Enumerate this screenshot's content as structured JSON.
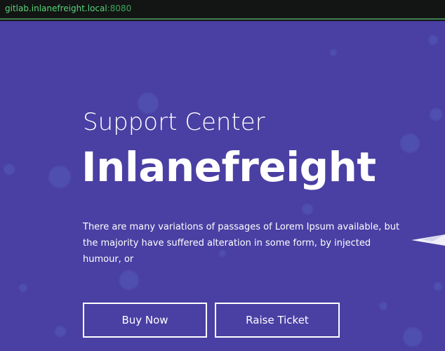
{
  "browser": {
    "url_host": "gitlab.inlanefreight.local",
    "url_port": ":8080"
  },
  "hero": {
    "subtitle": "Support Center",
    "title": "Inlanefreight",
    "description": "There are many variations of passages of Lorem Ipsum available, but the majority have suffered alteration in some form, by injected humour, or",
    "buy_label": "Buy Now",
    "raise_label": "Raise Ticket"
  },
  "colors": {
    "hero_background": "#4a3fa3",
    "url_text": "#58d47c",
    "text": "#ffffff"
  },
  "icons": {
    "decoration": "paper-plane-icon"
  }
}
